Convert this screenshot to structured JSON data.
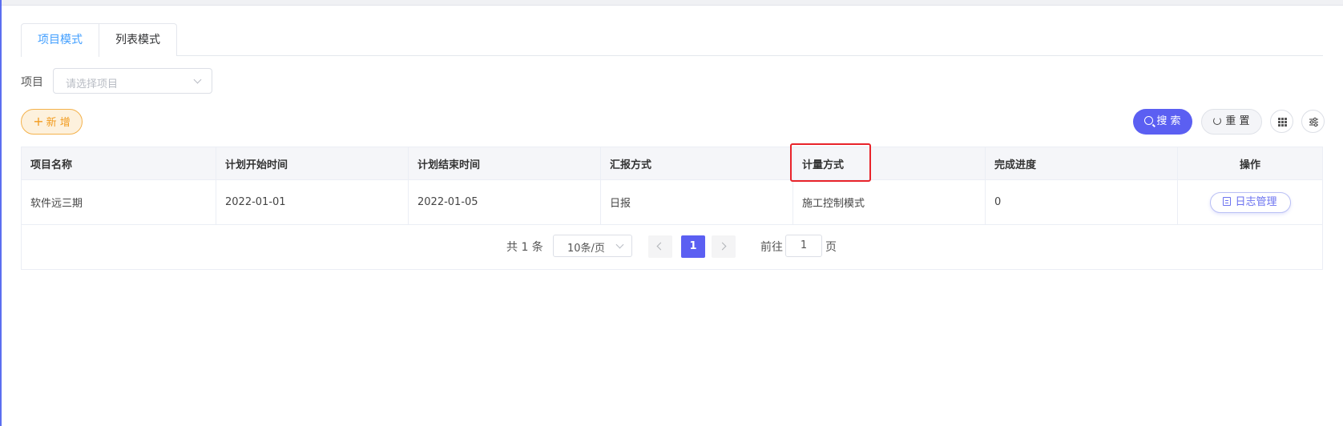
{
  "tabs": [
    {
      "label": "项目模式",
      "active": true
    },
    {
      "label": "列表模式",
      "active": false
    }
  ],
  "filter": {
    "label": "项目",
    "placeholder": "请选择项目"
  },
  "toolbar": {
    "add_label": "新 增",
    "search_label": "搜 索",
    "reset_label": "重 置"
  },
  "table": {
    "columns": [
      "项目名称",
      "计划开始时间",
      "计划结束时间",
      "汇报方式",
      "计量方式",
      "完成进度",
      "操作"
    ],
    "rows": [
      {
        "name": "软件远三期",
        "start": "2022-01-01",
        "end": "2022-01-05",
        "report": "日报",
        "measure": "施工控制模式",
        "progress": "0",
        "action": "日志管理"
      }
    ]
  },
  "pagination": {
    "total_text": "共 1 条",
    "page_size": "10条/页",
    "current_page": "1",
    "goto_label": "前往",
    "goto_value": "1",
    "goto_suffix": "页"
  },
  "colors": {
    "primary": "#5b5ff2",
    "tab_active": "#409eff",
    "add_orange": "#f29c1f",
    "highlight_red": "#e8232a"
  }
}
